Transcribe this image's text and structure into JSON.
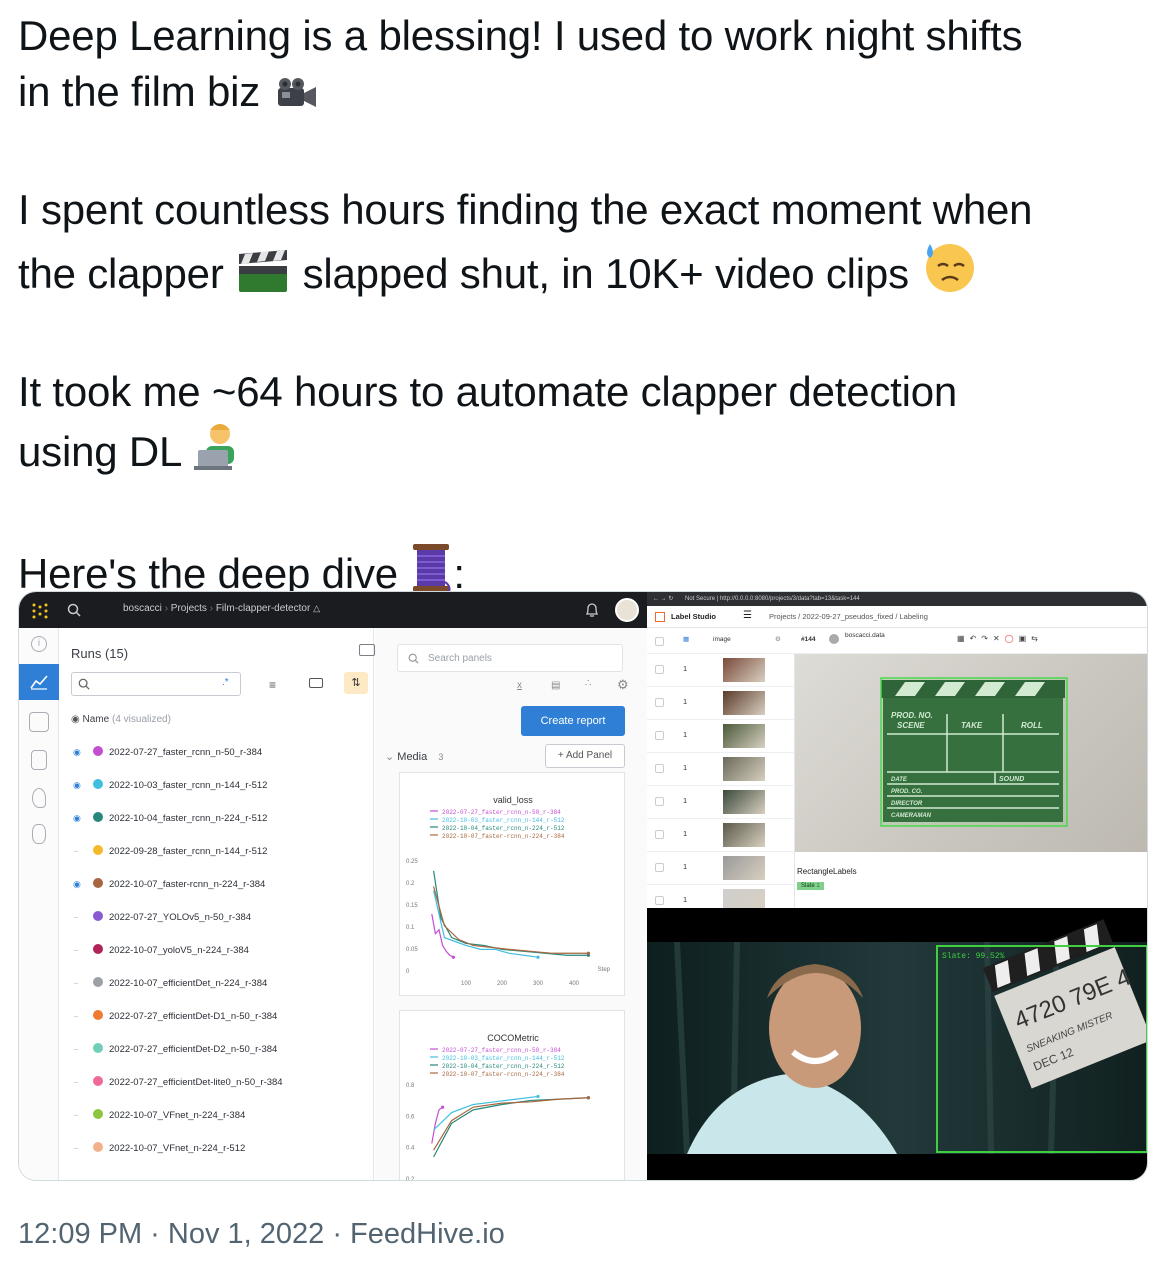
{
  "tweet": {
    "paragraphs": [
      [
        "Deep Learning is a blessing! I used to work night shifts",
        "in the film biz"
      ],
      [
        "I spent countless hours finding the exact moment when",
        "the clapper",
        "slapped shut, in 10K+ video clips"
      ],
      [
        "It took me ~64 hours to automate clapper detection",
        "using DL"
      ],
      [
        "Here's the deep dive",
        ":"
      ]
    ],
    "timestamp": "12:09 PM · Nov 1, 2022 · FeedHive.io"
  },
  "wandb": {
    "breadcrumb": [
      "boscacci",
      "Projects",
      "Film-clapper-detector"
    ],
    "runs_title": "Runs (15)",
    "search_regex": ".*",
    "column_header": "Name",
    "column_sub": "(4 visualized)",
    "runs": [
      {
        "name": "2022-07-27_faster_rcnn_n-50_r-384",
        "color": "#c44ed2",
        "visible": true
      },
      {
        "name": "2022-10-03_faster_rcnn_n-144_r-512",
        "color": "#3fbfe0",
        "visible": true
      },
      {
        "name": "2022-10-04_faster_rcnn_n-224_r-512",
        "color": "#26887a",
        "visible": true
      },
      {
        "name": "2022-09-28_faster_rcnn_n-144_r-512",
        "color": "#f3b92b",
        "visible": false
      },
      {
        "name": "2022-10-07_faster-rcnn_n-224_r-384",
        "color": "#a8663f",
        "visible": true
      },
      {
        "name": "2022-07-27_YOLOv5_n-50_r-384",
        "color": "#8a5bd0",
        "visible": false
      },
      {
        "name": "2022-10-07_yoloV5_n-224_r-384",
        "color": "#b0245a",
        "visible": false
      },
      {
        "name": "2022-10-07_efficientDet_n-224_r-384",
        "color": "#9aa0a6",
        "visible": false
      },
      {
        "name": "2022-07-27_efficientDet-D1_n-50_r-384",
        "color": "#ef7a32",
        "visible": false
      },
      {
        "name": "2022-07-27_efficientDet-D2_n-50_r-384",
        "color": "#6fcfb8",
        "visible": false
      },
      {
        "name": "2022-07-27_efficientDet-lite0_n-50_r-384",
        "color": "#ef6a9a",
        "visible": false
      },
      {
        "name": "2022-10-07_VFnet_n-224_r-384",
        "color": "#8cc63f",
        "visible": false
      },
      {
        "name": "2022-10-07_VFnet_n-224_r-512",
        "color": "#f2b08a",
        "visible": false
      }
    ],
    "search_panels_placeholder": "Search panels",
    "create_report": "Create report",
    "media_label": "Media",
    "media_count": "3",
    "add_panel": "Add Panel"
  },
  "chart_data": [
    {
      "type": "line",
      "title": "valid_loss",
      "xlabel": "Step",
      "xlim": [
        0,
        500
      ],
      "ylim": [
        0,
        0.28
      ],
      "yticks": [
        "0.25",
        "0.2",
        "0.15",
        "0.1",
        "0.05",
        "0"
      ],
      "xticks": [
        "100",
        "200",
        "300",
        "400"
      ],
      "legend": [
        "2022-07-27_faster_rcnn_n-50_r-384",
        "2022-10-03_faster_rcnn_n-144_r-512",
        "2022-10-04_faster_rcnn_n-224_r-512",
        "2022-10-07_faster-rcnn_n-224_r-384"
      ],
      "series": [
        {
          "name": "2022-07-27_faster_rcnn_n-50_r-384",
          "color": "#c44ed2",
          "x": [
            5,
            15,
            25,
            35,
            45,
            55,
            65
          ],
          "y": [
            0.14,
            0.09,
            0.1,
            0.06,
            0.045,
            0.035,
            0.03
          ]
        },
        {
          "name": "2022-10-03_faster_rcnn_n-144_r-512",
          "color": "#3fbfe0",
          "x": [
            10,
            40,
            70,
            100,
            140,
            180,
            220,
            260,
            300
          ],
          "y": [
            0.2,
            0.08,
            0.07,
            0.06,
            0.05,
            0.05,
            0.04,
            0.035,
            0.03
          ]
        },
        {
          "name": "2022-10-04_faster_rcnn_n-224_r-512",
          "color": "#26887a",
          "x": [
            10,
            30,
            60,
            100,
            150,
            200,
            260,
            320,
            380,
            440
          ],
          "y": [
            0.25,
            0.13,
            0.08,
            0.065,
            0.06,
            0.05,
            0.045,
            0.04,
            0.035,
            0.035
          ]
        },
        {
          "name": "2022-10-07_faster-rcnn_n-224_r-384",
          "color": "#a8663f",
          "x": [
            10,
            40,
            80,
            120,
            170,
            220,
            280,
            340,
            400,
            440
          ],
          "y": [
            0.21,
            0.11,
            0.075,
            0.06,
            0.055,
            0.05,
            0.045,
            0.04,
            0.04,
            0.04
          ]
        }
      ]
    },
    {
      "type": "line",
      "title": "COCOMetric",
      "ylim": [
        0.2,
        0.9
      ],
      "yticks": [
        "0.8",
        "0.6",
        "0.4",
        "0.2"
      ],
      "legend": [
        "2022-07-27_faster_rcnn_n-50_r-384",
        "2022-10-03_faster_rcnn_n-144_r-512",
        "2022-10-04_faster_rcnn_n-224_r-512",
        "2022-10-07_faster-rcnn_n-224_r-384"
      ],
      "series": [
        {
          "name": "2022-07-27_faster_rcnn_n-50_r-384",
          "color": "#c44ed2",
          "x": [
            5,
            15,
            25,
            35
          ],
          "y": [
            0.45,
            0.6,
            0.7,
            0.72
          ]
        },
        {
          "name": "2022-10-03_faster_rcnn_n-144_r-512",
          "color": "#3fbfe0",
          "x": [
            10,
            60,
            120,
            180,
            240,
            300
          ],
          "y": [
            0.55,
            0.68,
            0.74,
            0.76,
            0.78,
            0.8
          ]
        },
        {
          "name": "2022-10-04_faster_rcnn_n-224_r-512",
          "color": "#26887a",
          "x": [
            10,
            60,
            120,
            200,
            280,
            360,
            440
          ],
          "y": [
            0.35,
            0.6,
            0.7,
            0.74,
            0.77,
            0.78,
            0.79
          ]
        },
        {
          "name": "2022-10-07_faster-rcnn_n-224_r-384",
          "color": "#a8663f",
          "x": [
            10,
            60,
            120,
            200,
            280,
            360,
            440
          ],
          "y": [
            0.4,
            0.62,
            0.72,
            0.75,
            0.76,
            0.78,
            0.79
          ]
        }
      ]
    }
  ],
  "label_studio": {
    "url": "Not Secure  |  http://0.0.0.0:8080/projects/3/data?tab=13&task=144",
    "app_name": "Label Studio",
    "breadcrumb": "Projects  /  2022-09-27_pseudos_fixed  /  Labeling",
    "column_image": "image",
    "task_id": "#144",
    "user": "boscacci.data",
    "rows": [
      "1",
      "1",
      "1",
      "1",
      "1",
      "1",
      "1",
      "1"
    ],
    "clapper_text": {
      "prod": "PROD. NO.",
      "scene": "SCENE",
      "take": "TAKE",
      "roll": "ROLL",
      "date": "DATE",
      "sound": "SOUND",
      "prodco": "PROD. CO.",
      "director": "DIRECTOR",
      "camera": "CAMERAMAN"
    },
    "labels_title": "RectangleLabels",
    "label_tag": "Slate",
    "label_count": "1"
  },
  "video": {
    "detection": "Slate: 99.52%",
    "clapper_text": "4720 79E 4",
    "clapper_lines": [
      "SNEAKING MISTER",
      "DEC 12"
    ]
  }
}
